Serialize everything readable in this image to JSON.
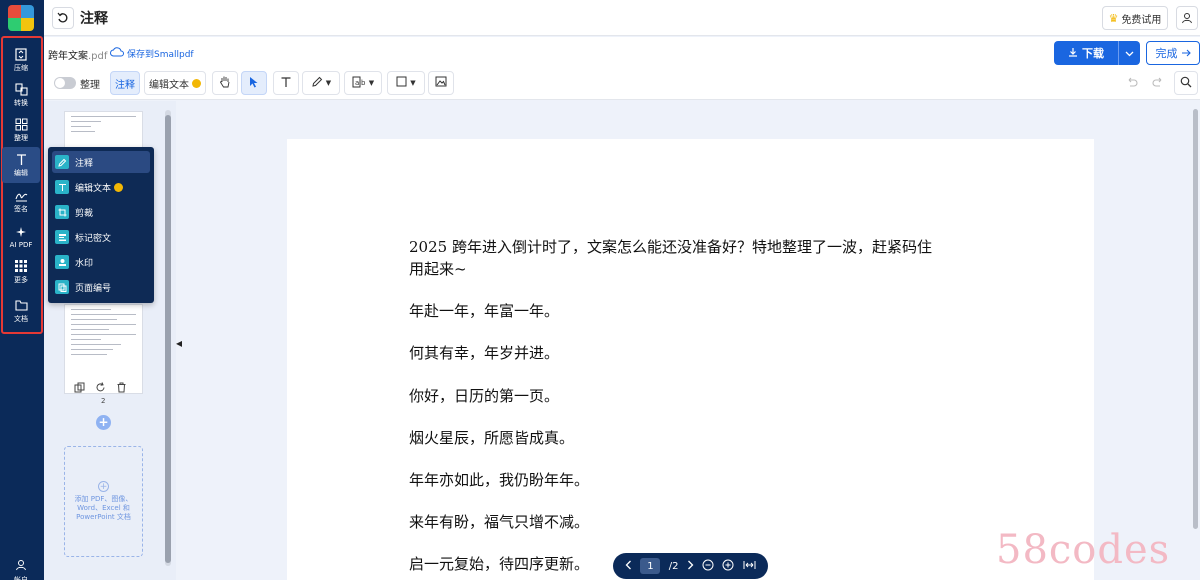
{
  "header": {
    "title": "注释",
    "trial_label": "免费试用"
  },
  "rail": {
    "items": [
      {
        "label": "压缩",
        "icon": "compress-icon"
      },
      {
        "label": "转换",
        "icon": "convert-icon"
      },
      {
        "label": "整理",
        "icon": "organize-icon"
      },
      {
        "label": "编辑",
        "icon": "edit-text-icon"
      },
      {
        "label": "签名",
        "icon": "signature-icon"
      },
      {
        "label": "AI PDF",
        "icon": "ai-sparkle-icon"
      },
      {
        "label": "更多",
        "icon": "grid-icon"
      },
      {
        "label": "文档",
        "icon": "folder-icon"
      }
    ],
    "account_label": "帐户",
    "active_item": "编辑"
  },
  "file": {
    "name": "跨年文案",
    "ext": ".pdf",
    "save_link": "保存到Smallpdf"
  },
  "actions": {
    "download_label": "下载",
    "done_label": "完成"
  },
  "toolbar": {
    "organize_label": "整理",
    "annotate_label": "注释",
    "edit_text_label": "编辑文本"
  },
  "menu": {
    "items": [
      {
        "label": "注释",
        "icon": "pen-icon",
        "active": true
      },
      {
        "label": "编辑文本",
        "icon": "text-icon",
        "premium": true
      },
      {
        "label": "剪裁",
        "icon": "crop-icon"
      },
      {
        "label": "标记密文",
        "icon": "redact-icon"
      },
      {
        "label": "水印",
        "icon": "watermark-icon"
      },
      {
        "label": "页面编号",
        "icon": "page-number-icon"
      }
    ]
  },
  "thumbnails": {
    "page_number": "2",
    "drop_text": "添加 PDF、图像、Word、Excel 和 PowerPoint 文档"
  },
  "document": {
    "lines": [
      "2025 跨年进入倒计时了，文案怎么能还没准备好？特地整理了一波，赶紧码住",
      "用起来~",
      "年赴一年，年富一年。",
      "何其有幸，年岁并进。",
      "你好，日历的第一页。",
      "烟火星辰，所愿皆成真。",
      "年年亦如此，我仍盼年年。",
      "来年有盼，福气只增不减。",
      "启一元复始，待四序更新。"
    ]
  },
  "pager": {
    "current": "1",
    "total": "/2"
  },
  "watermark": "58codes",
  "colors": {
    "rail_bg": "#0b2a59",
    "accent": "#1a66e0",
    "highlight_box": "#e53935",
    "menu_bg": "#0e2a55",
    "menu_icon_bg": "#2ab3c8",
    "premium_crown": "#f2b705"
  }
}
